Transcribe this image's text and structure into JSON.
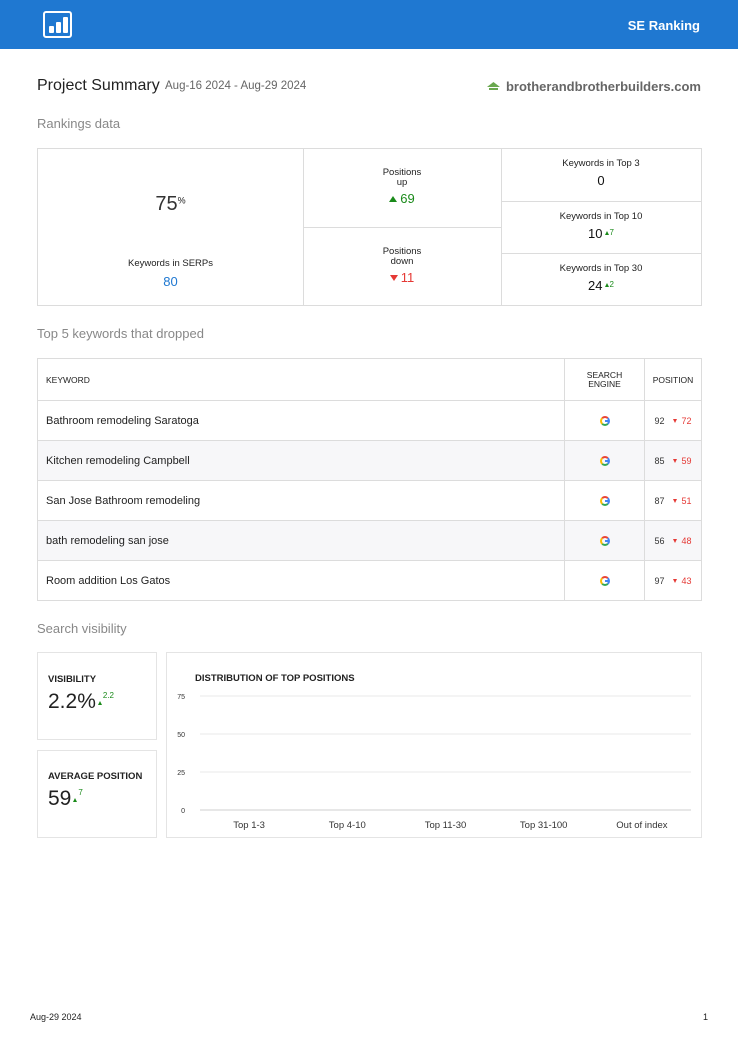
{
  "header": {
    "brand": "SE Ranking"
  },
  "summary": {
    "title": "Project Summary",
    "date_range": "Aug-16 2024 - Aug-29 2024",
    "domain": "brotherandbrotherbuilders.com"
  },
  "rankings": {
    "heading": "Rankings data",
    "serp_percent": "75",
    "percent_sign": "%",
    "serp_label": "Keywords in SERPs",
    "serp_count": "80",
    "up_label_1": "Positions",
    "up_label_2": "up",
    "up_value": "69",
    "down_label_1": "Positions",
    "down_label_2": "down",
    "down_value": "11",
    "top3_label": "Keywords in Top 3",
    "top3_value": "0",
    "top10_label": "Keywords in Top 10",
    "top10_value": "10",
    "top10_delta": "7",
    "top30_label": "Keywords in Top 30",
    "top30_value": "24",
    "top30_delta": "2"
  },
  "dropped": {
    "heading": "Top 5 keywords that dropped",
    "col_keyword": "KEYWORD",
    "col_engine_1": "SEARCH",
    "col_engine_2": "ENGINE",
    "col_position": "POSITION",
    "rows": [
      {
        "keyword": "Bathroom remodeling Saratoga",
        "old": "92",
        "new": "72"
      },
      {
        "keyword": "Kitchen remodeling Campbell",
        "old": "85",
        "new": "59"
      },
      {
        "keyword": "San Jose Bathroom remodeling",
        "old": "87",
        "new": "51"
      },
      {
        "keyword": "bath remodeling san jose",
        "old": "56",
        "new": "48"
      },
      {
        "keyword": "Room addition Los Gatos",
        "old": "97",
        "new": "43"
      }
    ]
  },
  "visibility": {
    "heading": "Search visibility",
    "vis_label": "VISIBILITY",
    "vis_value": "2.2%",
    "vis_delta": "2.2",
    "avg_label": "AVERAGE POSITION",
    "avg_value": "59",
    "avg_delta": "7"
  },
  "chart_data": {
    "type": "bar",
    "title": "DISTRIBUTION OF TOP POSITIONS",
    "categories": [
      "Top 1-3",
      "Top 4-10",
      "Top 11-30",
      "Top 31-100",
      "Out of index"
    ],
    "values": [
      0,
      0,
      0,
      0,
      0
    ],
    "yticks": [
      0,
      25,
      50,
      75
    ],
    "ylim": [
      0,
      75
    ],
    "grid": true
  },
  "footer": {
    "date": "Aug-29 2024",
    "page": "1"
  }
}
